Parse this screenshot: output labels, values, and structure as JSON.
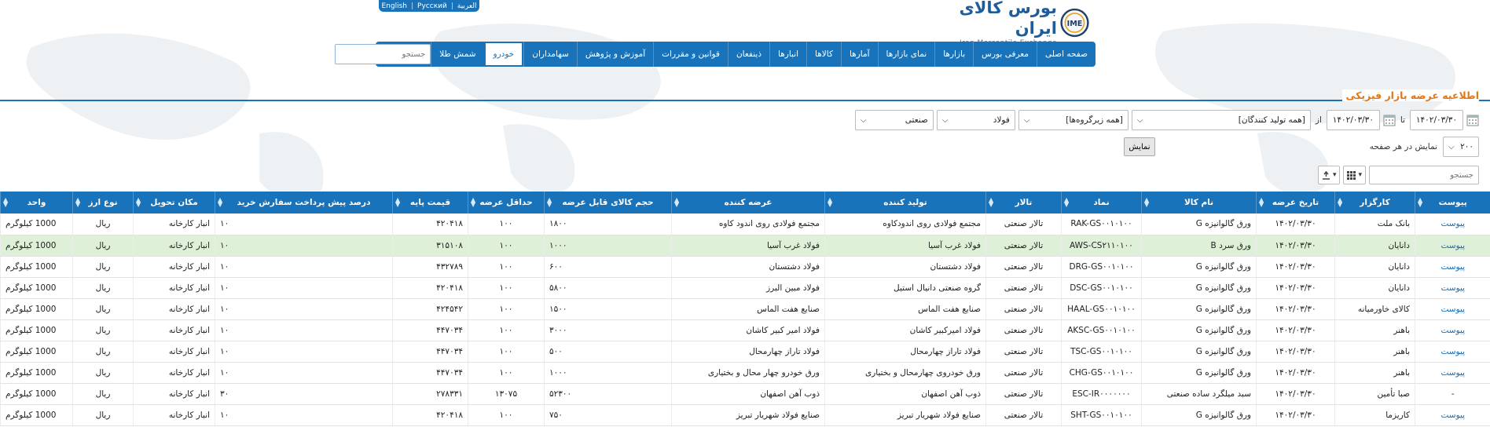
{
  "lang": [
    "English",
    "Русский",
    "العربية"
  ],
  "logo": {
    "fa": "بورس کالای ایران",
    "en": "Iran Mercantile Exchange"
  },
  "nav": {
    "items": [
      "صفحه اصلی",
      "معرفی بورس",
      "بازارها",
      "نمای بازارها",
      "آمارها",
      "کالاها",
      "انبارها",
      "ذینفعان",
      "قوانین و مقررات",
      "آموزش و پژوهش",
      "سهامداران",
      "خودرو",
      "شمش طلا"
    ],
    "active_index": 11,
    "search_placeholder": "جستجو"
  },
  "page_title": "اطلاعیه عرضه بازار فیزیکی",
  "filters": {
    "market": "صنعتی",
    "group": "فولاد",
    "subgroup": "[همه زیرگروه‌ها]",
    "producer": "[همه تولید کنندگان]",
    "from_label": "از",
    "from_date": "۱۴۰۲/۰۳/۳۰",
    "to_label": "تا",
    "to_date": "۱۴۰۲/۰۳/۳۰"
  },
  "per_page": {
    "label": "نمایش در هر صفحه",
    "value": "۲۰۰",
    "button": "نمایش"
  },
  "table_search_placeholder": "جستجو",
  "table": {
    "headers": [
      "پیوست",
      "کارگزار",
      "تاریخ عرضه",
      "نام کالا",
      "نماد",
      "تالار",
      "تولید کننده",
      "عرضه کننده",
      "حجم کالای قابل عرضه",
      "حداقل عرضه",
      "قیمت پایه",
      "درصد پیش پرداخت سفارش خرید",
      "مکان تحویل",
      "نوع ارز",
      "واحد"
    ],
    "rows": [
      [
        "پیوست",
        "بانک ملت",
        "۱۴۰۲/۰۳/۳۰",
        "ورق گالوانیزه G",
        "RAK-GS۰۰۱۰۱۰۰",
        "تالار صنعتی",
        "مجتمع فولادی روی اندودکاوه",
        "مجتمع فولادی روی اندود کاوه",
        "۱۸۰۰",
        "۱۰۰",
        "۴۲۰۴۱۸",
        "۱۰",
        "انبار کارخانه",
        "ریال",
        "1000 کیلوگرم"
      ],
      [
        "پیوست",
        "دانایان",
        "۱۴۰۲/۰۳/۳۰",
        "ورق سرد B",
        "AWS-CS۲۱۱۰۱۰۰",
        "تالار صنعتی",
        "فولاد غرب آسیا",
        "فولاد غرب آسیا",
        "۱۰۰۰",
        "۱۰۰",
        "۳۱۵۱۰۸",
        "۱۰",
        "انبار کارخانه",
        "ریال",
        "1000 کیلوگرم"
      ],
      [
        "پیوست",
        "دانایان",
        "۱۴۰۲/۰۳/۳۰",
        "ورق گالوانیزه G",
        "DRG-GS۰۰۱۰۱۰۰",
        "تالار صنعتی",
        "فولاد دشتستان",
        "فولاد دشتستان",
        "۶۰۰",
        "۱۰۰",
        "۴۳۲۷۸۹",
        "۱۰",
        "انبار کارخانه",
        "ریال",
        "1000 کیلوگرم"
      ],
      [
        "پیوست",
        "دانایان",
        "۱۴۰۲/۰۳/۳۰",
        "ورق گالوانیزه G",
        "DSC-GS۰۰۱۰۱۰۰",
        "تالار صنعتی",
        "گروه صنعتی دانیال استیل",
        "فولاد مبین البرز",
        "۵۸۰۰",
        "۱۰۰",
        "۴۲۰۴۱۸",
        "۱۰",
        "انبار کارخانه",
        "ریال",
        "1000 کیلوگرم"
      ],
      [
        "پیوست",
        "کالای خاورمیانه",
        "۱۴۰۲/۰۳/۳۰",
        "ورق گالوانیزه G",
        "HAAL-GS۰۰۱۰۱۰۰",
        "تالار صنعتی",
        "صنایع هفت الماس",
        "صنایع هفت الماس",
        "۱۵۰۰",
        "۱۰۰",
        "۴۲۴۵۴۲",
        "۱۰",
        "انبار کارخانه",
        "ریال",
        "1000 کیلوگرم"
      ],
      [
        "پیوست",
        "باهنر",
        "۱۴۰۲/۰۳/۳۰",
        "ورق گالوانیزه G",
        "AKSC-GS۰۰۱۰۱۰۰",
        "تالار صنعتی",
        "فولاد امیرکبیر کاشان",
        "فولاد امیر کبیر کاشان",
        "۳۰۰۰",
        "۱۰۰",
        "۴۴۷۰۳۴",
        "۱۰",
        "انبار کارخانه",
        "ریال",
        "1000 کیلوگرم"
      ],
      [
        "پیوست",
        "باهنر",
        "۱۴۰۲/۰۳/۳۰",
        "ورق گالوانیزه G",
        "TSC-GS۰۰۱۰۱۰۰",
        "تالار صنعتی",
        "فولاد تاراز چهارمحال",
        "فولاد تاراز چهارمحال",
        "۵۰۰",
        "۱۰۰",
        "۴۴۷۰۳۴",
        "۱۰",
        "انبار کارخانه",
        "ریال",
        "1000 کیلوگرم"
      ],
      [
        "پیوست",
        "باهنر",
        "۱۴۰۲/۰۳/۳۰",
        "ورق گالوانیزه G",
        "CHG-GS۰۰۱۰۱۰۰",
        "تالار صنعتی",
        "ورق خودروی چهارمحال و بختیاری",
        "ورق خودرو چهار محال و بختیاری",
        "۱۰۰۰",
        "۱۰۰",
        "۴۴۷۰۳۴",
        "۱۰",
        "انبار کارخانه",
        "ریال",
        "1000 کیلوگرم"
      ],
      [
        "-",
        "صبا تأمین",
        "۱۴۰۲/۰۳/۳۰",
        "سبد میلگرد ساده صنعتی",
        "ESC-IR۰۰۰۰۰۰۰",
        "تالار صنعتی",
        "ذوب آهن اصفهان",
        "ذوب آهن اصفهان",
        "۵۲۳۰۰",
        "۱۳۰۷۵",
        "۲۷۸۳۳۱",
        "۳۰",
        "انبار کارخانه",
        "ریال",
        "1000 کیلوگرم"
      ],
      [
        "پیوست",
        "کاریزما",
        "۱۴۰۲/۰۳/۳۰",
        "ورق گالوانیزه G",
        "SHT-GS۰۰۱۰۱۰۰",
        "تالار صنعتی",
        "صنایع فولاد شهریار تبریز",
        "صنایع فولاد شهریار تبریز",
        "۷۵۰",
        "۱۰۰",
        "۴۲۰۴۱۸",
        "۱۰",
        "انبار کارخانه",
        "ریال",
        "1000 کیلوگرم"
      ]
    ],
    "highlight_row": 1
  },
  "colors": {
    "nav_blue": "#1873ba",
    "title_orange": "#e0771b",
    "link_blue": "#1a6fb5",
    "highlight": "#dff0d8"
  },
  "icons": [
    "logo-emblem-icon",
    "calendar-icon",
    "chevron-down-icon",
    "sort-icon",
    "grid-columns-icon",
    "export-icon"
  ]
}
